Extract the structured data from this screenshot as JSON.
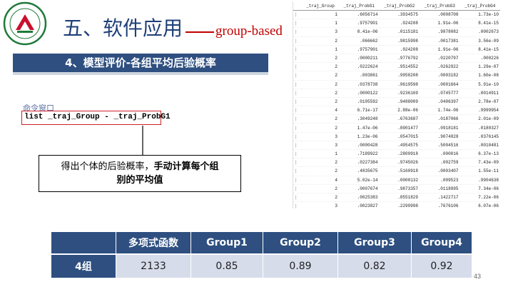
{
  "slide": {
    "title_cn": "五、软件应用",
    "title_en": "group-based",
    "section_banner": "4、模型评价-各组平均后验概率",
    "page_number": "43"
  },
  "stata": {
    "window_label": "命令窗口",
    "command": "list _traj_Group - _traj_ProbG1",
    "columns": [
      "_traj_Group",
      "_traj_ProbG1",
      "_traj_ProbG2",
      "_traj_ProbG3",
      "_traj_ProbG4"
    ],
    "rows": [
      [
        "1",
        ".6056714",
        ".3934575",
        ".0008708",
        "1.73e-10"
      ],
      [
        "1",
        ".9757901",
        ".024208",
        "1.91e-06",
        "8.41e-15"
      ],
      [
        "3",
        "8.41e-06",
        ".0115181",
        ".9878082",
        ".0002673"
      ],
      [
        "2",
        ".066662",
        ".9815998",
        ".0017381",
        "3.56e-09"
      ],
      [
        "1",
        ".9757901",
        ".024208",
        "1.91e-06",
        "8.41e-15"
      ],
      [
        "2",
        ".0000211",
        ".9776792",
        ".0220797",
        ".000226"
      ],
      [
        "2",
        ".0222624",
        ".9514552",
        ".0262922",
        "1.29e-07"
      ],
      [
        "2",
        ".003861",
        ".9958208",
        ".0003182",
        "1.60e-08"
      ],
      [
        "2",
        ".0378738",
        ".9619598",
        ".0001664",
        "5.91e-10"
      ],
      [
        "2",
        ".0000122",
        ".9236169",
        ".0745777",
        ".0014911"
      ],
      [
        "2",
        ".0105592",
        ".9488009",
        ".0406397",
        "2.78e-07"
      ],
      [
        "4",
        "6.71e-17",
        "2.88e-06",
        "1.74e-06",
        ".9999954"
      ],
      [
        "2",
        ".3049248",
        ".6763687",
        ".0187066",
        "2.01e-09"
      ],
      [
        "2",
        "1.47e-06",
        ".8901477",
        ".0918181",
        ".0180327"
      ],
      [
        "3",
        "1.23e-06",
        ".0547015",
        ".9074828",
        ".0376145"
      ],
      [
        "3",
        ".0000428",
        ".4954575",
        ".5004516",
        ".0010481"
      ],
      [
        "1",
        ".7189922",
        ".2809918",
        ".000016",
        "6.37e-13"
      ],
      [
        "2",
        ".0227384",
        ".9745026",
        ".002759",
        "7.43e-09"
      ],
      [
        "2",
        ".4835675",
        ".5160918",
        ".0003407",
        "1.55e-11"
      ],
      [
        "4",
        "5.02e-14",
        ".0000132",
        ".009523",
        ".9904638"
      ],
      [
        "2",
        ".0007674",
        ".9873357",
        ".0118895",
        "7.34e-06"
      ],
      [
        "2",
        ".0025383",
        ".8551829",
        ".1422717",
        "7.22e-06"
      ],
      [
        "3",
        ".0023827",
        ".2299998",
        ".7676106",
        "6.07e-06"
      ]
    ]
  },
  "callout": {
    "text_normal": "得出个体的后验概率，",
    "text_bold_line1": "手动计算每个组",
    "text_bold_line2": "别的平均值"
  },
  "result_table": {
    "headers": [
      "",
      "多项式函数",
      "Group1",
      "Group2",
      "Group3",
      "Group4"
    ],
    "row": [
      "4组",
      "2133",
      "0.85",
      "0.89",
      "0.82",
      "0.92"
    ]
  },
  "colors": {
    "primary": "#2e4f80",
    "accent": "#c00000",
    "row_bg": "#d6dcea"
  }
}
